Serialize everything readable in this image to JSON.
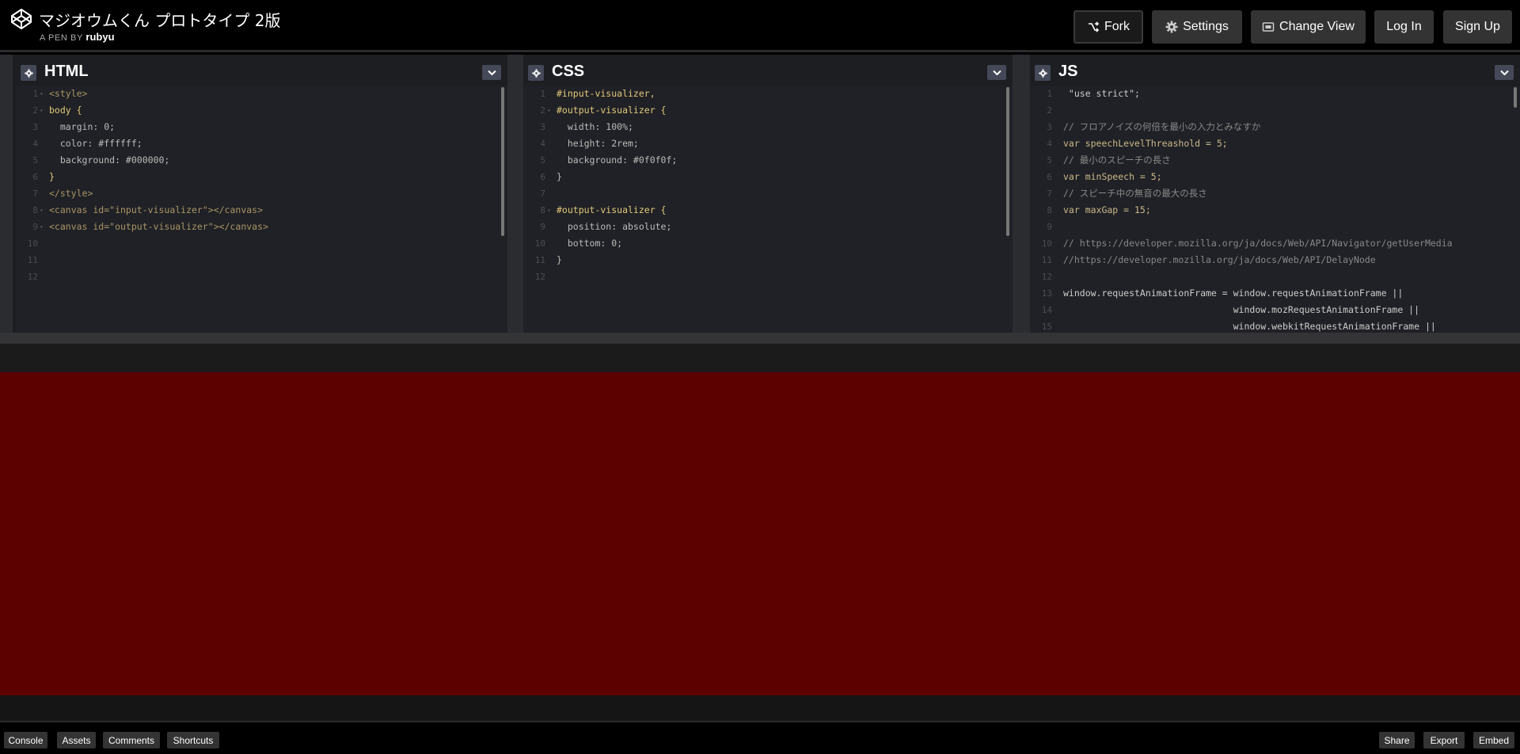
{
  "header": {
    "title": "マジオウムくん プロトタイプ 2版",
    "byline_prefix": "A PEN BY",
    "author": "rubyu",
    "buttons": {
      "fork": "Fork",
      "settings": "Settings",
      "change_view": "Change View",
      "login": "Log In",
      "signup": "Sign Up"
    }
  },
  "editors": {
    "html": {
      "name": "HTML",
      "line_numbers": [
        "1",
        "2",
        "3",
        "4",
        "5",
        "6",
        "7",
        "8",
        "9",
        "10",
        "11",
        "12"
      ],
      "lines": [
        "<style>",
        "body {",
        "  margin: 0;",
        "  color: #ffffff;",
        "  background: #000000;",
        "}",
        "</style>",
        "<canvas id=\"input-visualizer\"></canvas>",
        "<canvas id=\"output-visualizer\"></canvas>",
        "",
        "",
        ""
      ]
    },
    "css": {
      "name": "CSS",
      "line_numbers": [
        "1",
        "2",
        "3",
        "4",
        "5",
        "6",
        "7",
        "8",
        "9",
        "10",
        "11",
        "12"
      ],
      "lines": [
        "#input-visualizer,",
        "#output-visualizer {",
        "  width: 100%;",
        "  height: 2rem;",
        "  background: #0f0f0f;",
        "}",
        "",
        "#output-visualizer {",
        "  position: absolute;",
        "  bottom: 0;",
        "}",
        ""
      ]
    },
    "js": {
      "name": "JS",
      "line_numbers": [
        "1",
        "2",
        "3",
        "4",
        "5",
        "6",
        "7",
        "8",
        "9",
        "10",
        "11",
        "12",
        "13",
        "14",
        "15"
      ],
      "lines": [
        " \"use strict\";",
        "",
        "// フロアノイズの何倍を最小の入力とみなすか",
        "var speechLevelThreashold = 5;",
        "// 最小のスピーチの長さ",
        "var minSpeech = 5;",
        "// スピーチ中の無音の最大の長さ",
        "var maxGap = 15;",
        "",
        "// https://developer.mozilla.org/ja/docs/Web/API/Navigator/getUserMedia",
        "//https://developer.mozilla.org/ja/docs/Web/API/DelayNode",
        "",
        "window.requestAnimationFrame = window.requestAnimationFrame ||",
        "                               window.mozRequestAnimationFrame ||",
        "                               window.webkitRequestAnimationFrame ||"
      ]
    }
  },
  "footer": {
    "left": [
      "Console",
      "Assets",
      "Comments",
      "Shortcuts"
    ],
    "right": [
      "Share",
      "Export",
      "Embed"
    ]
  },
  "colors": {
    "preview_bg": "#5d0000",
    "editor_bg": "#1d1e22"
  }
}
